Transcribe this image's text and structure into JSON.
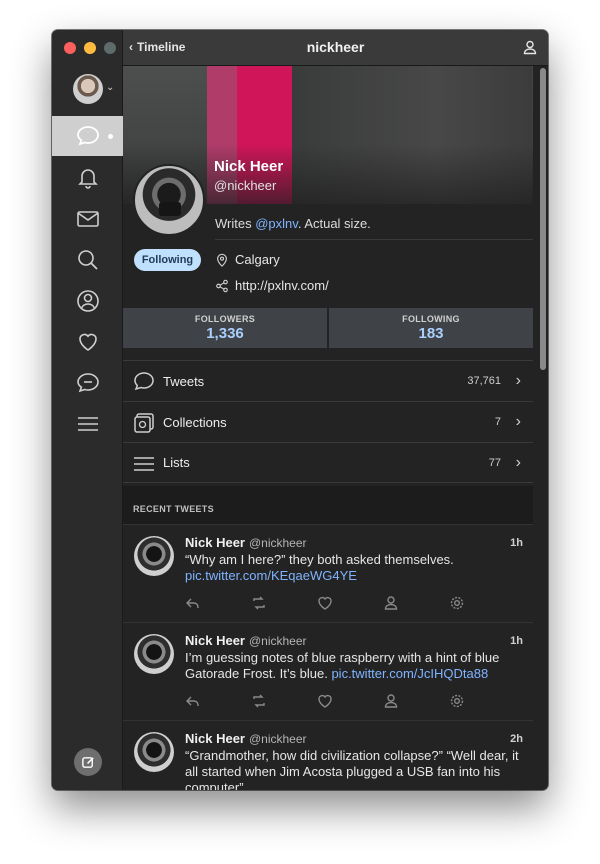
{
  "window": {
    "back_label": "Timeline",
    "title": "nickheer"
  },
  "sidebar": {
    "items": [
      {
        "name": "timeline-icon"
      },
      {
        "name": "bell-icon"
      },
      {
        "name": "mail-icon"
      },
      {
        "name": "search-icon"
      },
      {
        "name": "profile-icon"
      },
      {
        "name": "heart-icon"
      },
      {
        "name": "mute-icon"
      },
      {
        "name": "menu-icon"
      }
    ],
    "compose_icon": "compose-icon"
  },
  "profile": {
    "name": "Nick Heer",
    "handle": "@nickheer",
    "bio_prefix": "Writes ",
    "bio_mention": "@pxlnv",
    "bio_suffix": ". Actual size.",
    "following_label": "Following",
    "location": "Calgary",
    "url": "http://pxlnv.com/"
  },
  "stats": {
    "followers_label": "FOLLOWERS",
    "followers_value": "1,336",
    "following_label": "FOLLOWING",
    "following_value": "183"
  },
  "menu": [
    {
      "label": "Tweets",
      "count": "37,761"
    },
    {
      "label": "Collections",
      "count": "7"
    },
    {
      "label": "Lists",
      "count": "77"
    }
  ],
  "recent_tweets_label": "RECENT TWEETS",
  "tweets": [
    {
      "name": "Nick Heer",
      "handle": "@nickheer",
      "time": "1h",
      "text": "“Why am I here?” they both asked themselves.",
      "link": "pic.twitter.com/KEqaeWG4YE"
    },
    {
      "name": "Nick Heer",
      "handle": "@nickheer",
      "time": "1h",
      "text": "I’m guessing notes of blue raspberry with a hint of blue Gatorade Frost. It’s blue. ",
      "link": "pic.twitter.com/JcIHQDta88"
    },
    {
      "name": "Nick Heer",
      "handle": "@nickheer",
      "time": "2h",
      "text": "“Grandmother, how did civilization collapse?” “Well dear, it all started when Jim Acosta plugged a USB fan into his computer”",
      "link": ""
    }
  ],
  "colors": {
    "accent": "#7fb4ff",
    "following_button": "#bfe0ff",
    "banner_pink": "#d01558"
  }
}
